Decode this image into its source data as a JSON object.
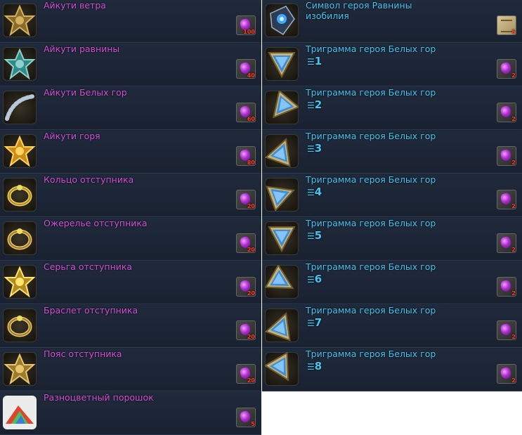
{
  "left_items": [
    {
      "name": "Айкути ветра",
      "qty": "100",
      "icon": "wind-emblem-icon"
    },
    {
      "name": "Айкути равнины",
      "qty": "40",
      "icon": "plains-emblem-icon"
    },
    {
      "name": "Айкути Белых гор",
      "qty": "60",
      "icon": "white-mountains-emblem-icon"
    },
    {
      "name": "Айкути горя",
      "qty": "80",
      "icon": "sorrow-emblem-icon"
    },
    {
      "name": "Кольцо отступника",
      "qty": "20",
      "icon": "ring-icon"
    },
    {
      "name": "Ожерелье отступника",
      "qty": "20",
      "icon": "necklace-icon"
    },
    {
      "name": "Серьга отступника",
      "qty": "20",
      "icon": "earring-icon"
    },
    {
      "name": "Браслет отступника",
      "qty": "20",
      "icon": "bracelet-icon"
    },
    {
      "name": "Пояс отступника",
      "qty": "20",
      "icon": "belt-icon"
    },
    {
      "name": "Разноцветный порошок",
      "qty": "5",
      "icon": "colorful-powder-icon"
    }
  ],
  "right_items": [
    {
      "name": "Символ героя Равнины изобилия",
      "num": "",
      "qty": "5",
      "reward": "scroll",
      "icon": "hero-symbol-icon"
    },
    {
      "name": "Триграмма героя Белых гор",
      "num": "1",
      "qty": "2",
      "reward": "gem",
      "icon": "trigram-icon"
    },
    {
      "name": "Триграмма героя Белых гор",
      "num": "2",
      "qty": "2",
      "reward": "gem",
      "icon": "trigram-icon"
    },
    {
      "name": "Триграмма героя Белых гор",
      "num": "3",
      "qty": "2",
      "reward": "gem",
      "icon": "trigram-icon"
    },
    {
      "name": "Триграмма героя Белых гор",
      "num": "4",
      "qty": "2",
      "reward": "gem",
      "icon": "trigram-icon"
    },
    {
      "name": "Триграмма героя Белых гор",
      "num": "5",
      "qty": "2",
      "reward": "gem",
      "icon": "trigram-icon"
    },
    {
      "name": "Триграмма героя Белых гор",
      "num": "6",
      "qty": "2",
      "reward": "gem",
      "icon": "trigram-icon"
    },
    {
      "name": "Триграмма героя Белых гор",
      "num": "7",
      "qty": "2",
      "reward": "gem",
      "icon": "trigram-icon"
    },
    {
      "name": "Триграмма героя Белых гор",
      "num": "8",
      "qty": "2",
      "reward": "gem",
      "icon": "trigram-icon"
    }
  ],
  "colors": {
    "left_name": "#d34fd8",
    "right_name": "#46c4f0",
    "qty": "#ff3a2a",
    "panel": "#1c2433"
  }
}
